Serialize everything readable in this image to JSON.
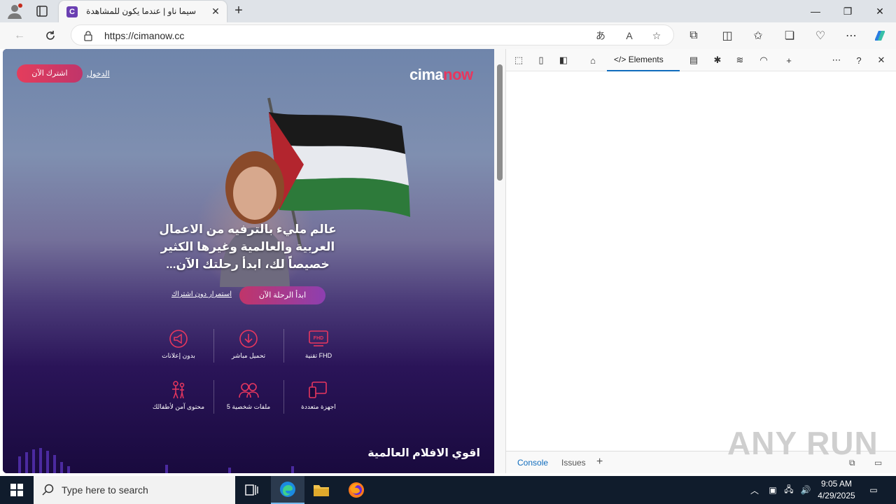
{
  "browser": {
    "tab_title": "سيما ناو | عندما يكون للمشاهدة متعة",
    "url": "https://cimanow.cc",
    "window_controls": [
      "minimize",
      "restore",
      "close"
    ]
  },
  "site": {
    "logo_part1": "cima",
    "logo_part2": "now",
    "subscribe_label": "اشترك الآن",
    "login_label": "الدخول",
    "headline": "عالم مليء بالترفيه من الاعمال العربية والعالمية وغيرها الكثير خصيصاً لك، ابدأ رحلتك الآن...",
    "cta_label": "ابدأ الرحلة الآن",
    "continue_label": "استمرار دون اشتراك",
    "features_row1": [
      {
        "label": "تقنية FHD",
        "icon": "fhd-icon"
      },
      {
        "label": "تحميل مباشر",
        "icon": "download-icon"
      },
      {
        "label": "بدون إعلانات",
        "icon": "no-ads-icon"
      }
    ],
    "features_row2": [
      {
        "label": "اجهزة متعددة",
        "icon": "devices-icon"
      },
      {
        "label": "5 ملفات شخصية",
        "icon": "profiles-icon"
      },
      {
        "label": "محتوى آمن لأطفالك",
        "icon": "kids-icon"
      }
    ],
    "fhd_badge": "FHD",
    "section_title": "اقوي الافلام العالمية",
    "accent_color": "#e8365e"
  },
  "devtools": {
    "elements_tab": "Elements",
    "drawer_tabs": [
      "Console",
      "Issues"
    ]
  },
  "watermark": "ANY RUN",
  "taskbar": {
    "search_placeholder": "Type here to search",
    "time": "9:05 AM",
    "date": "4/29/2025"
  }
}
